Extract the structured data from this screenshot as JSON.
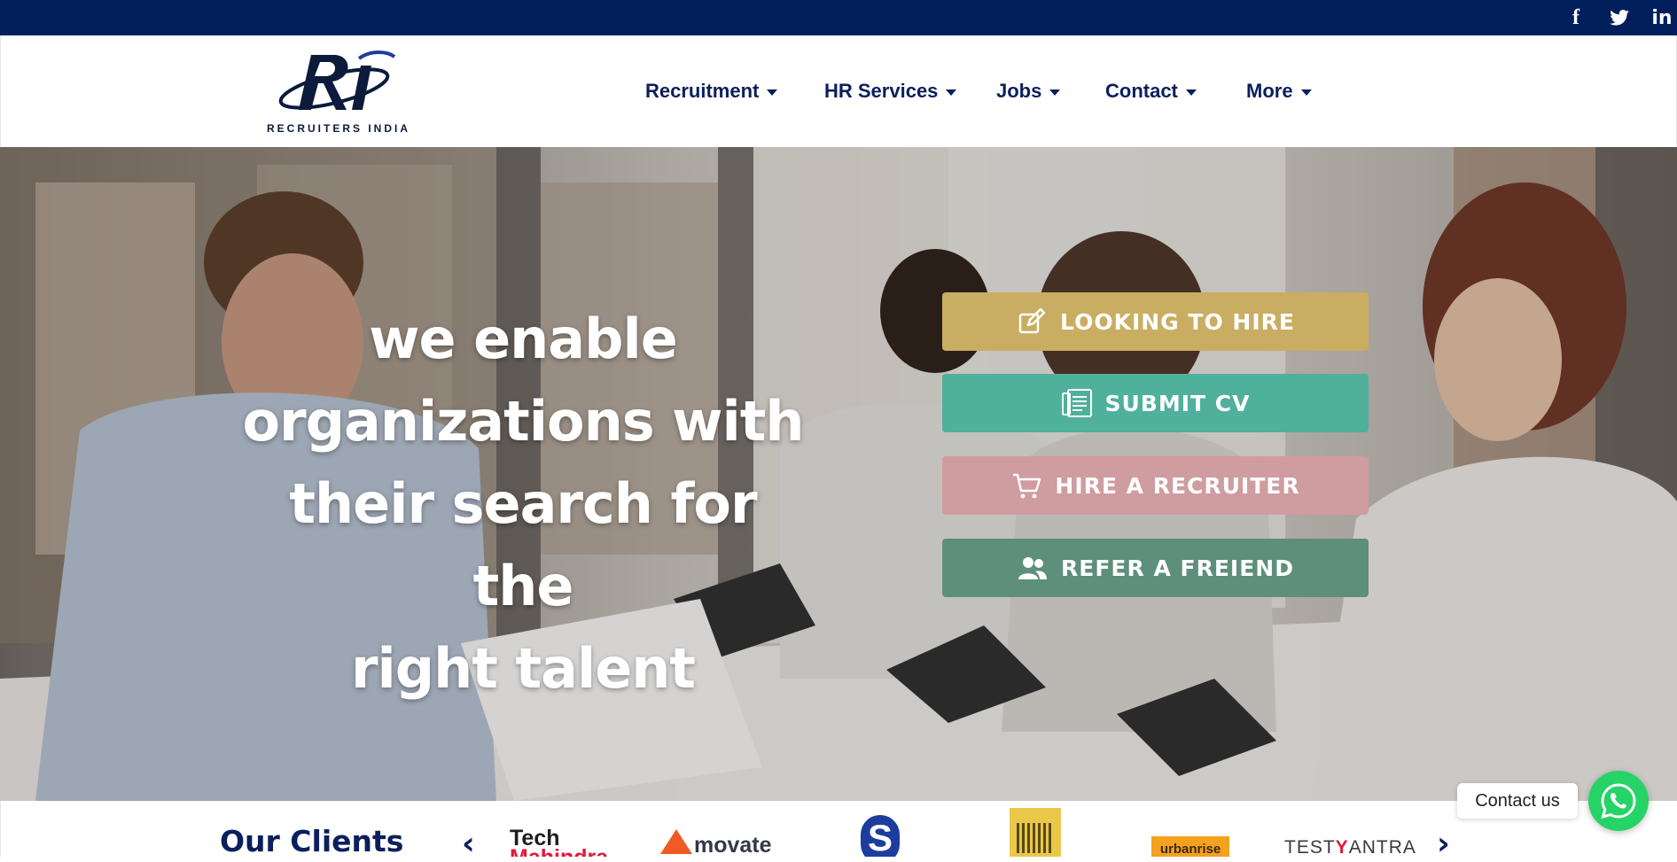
{
  "social": {
    "facebook": "f",
    "linkedin": "in",
    "icons": [
      "facebook-icon",
      "twitter-icon",
      "linkedin-icon"
    ]
  },
  "brand": {
    "logo_text": "RECRUITERS INDIA",
    "primary_color": "#001f5b"
  },
  "nav": {
    "items": [
      {
        "label": "Recruitment"
      },
      {
        "label": "HR Services"
      },
      {
        "label": "Jobs"
      },
      {
        "label": "Contact"
      },
      {
        "label": "More"
      }
    ]
  },
  "hero": {
    "headline_lines": [
      "we enable",
      "organizations with",
      "their search for the",
      "right talent"
    ],
    "cta": [
      {
        "label": "LOOKING TO HIRE",
        "icon": "edit-icon",
        "color": "#c9ad62"
      },
      {
        "label": "SUBMIT CV",
        "icon": "document-icon",
        "color": "#4fb09c"
      },
      {
        "label": "HIRE A RECRUITER",
        "icon": "cart-icon",
        "color": "#cf9ca0"
      },
      {
        "label": "REFER A FREIEND",
        "icon": "users-icon",
        "color": "#5e8f7a"
      }
    ]
  },
  "clients": {
    "title": "Our Clients",
    "logos": {
      "tech_line1": "Tech",
      "tech_line2": "Mahindra",
      "movate": "movate",
      "s_logo": "S",
      "urbanrise": "urbanrise",
      "testyantra_a": "TEST",
      "testyantra_b": "Y",
      "testyantra_c": "ANTRA"
    }
  },
  "contact": {
    "label": "Contact us",
    "icon": "whatsapp-icon"
  }
}
